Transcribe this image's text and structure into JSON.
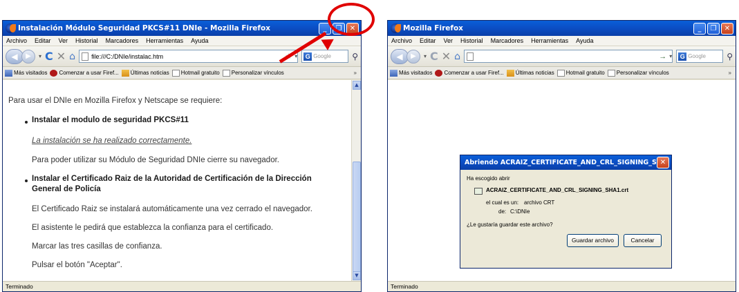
{
  "window1": {
    "title": "Instalación Módulo Seguridad PKCS#11 DNIe - Mozilla Firefox",
    "menu": [
      "Archivo",
      "Editar",
      "Ver",
      "Historial",
      "Marcadores",
      "Herramientas",
      "Ayuda"
    ],
    "url": "file:///C:/DNIe/instalac.htm",
    "search_placeholder": "Google",
    "bookmarks": [
      "Más visitados",
      "Comenzar a usar Firef...",
      "Últimas noticias",
      "Hotmail gratuito",
      "Personalizar vínculos"
    ],
    "status": "Terminado",
    "content": {
      "intro": "Para usar el DNIe en Mozilla Firefox y Netscape se requiere:",
      "bullet1": "Instalar el modulo de seguridad PKCS#11",
      "success_link": "La instalación se ha realizado correctamente.",
      "close_note": "Para poder utilizar su Módulo de Seguridad DNIe cierre su navegador.",
      "bullet2_line1": "Instalar el Certificado Raiz de la Autoridad de Certificación de la Dirección",
      "bullet2_line2": "General de Policía",
      "step1": "El Certificado Raiz se instalará automáticamente una vez cerrado el navegador.",
      "step2": "El asistente le pedirá que establezca la confianza para el certificado.",
      "step3": "Marcar las tres casillas de confianza.",
      "step4": "Pulsar el botón \"Aceptar\"."
    }
  },
  "window2": {
    "title": "Mozilla Firefox",
    "menu": [
      "Archivo",
      "Editar",
      "Ver",
      "Historial",
      "Marcadores",
      "Herramientas",
      "Ayuda"
    ],
    "url": "",
    "search_placeholder": "Google",
    "bookmarks": [
      "Más visitados",
      "Comenzar a usar Firef...",
      "Últimas noticias",
      "Hotmail gratuito",
      "Personalizar vínculos"
    ],
    "status": "Terminado",
    "dialog": {
      "title": "Abriendo ACRAIZ_CERTIFICATE_AND_CRL_SIGNING_S...",
      "chosen_label": "Ha escogido abrir",
      "filename": "ACRAIZ_CERTIFICATE_AND_CRL_SIGNING_SHA1.crt",
      "type_label": "el cual es un:",
      "type_value": "archivo CRT",
      "from_label": "de:",
      "from_value": "C:\\DNIe",
      "question": "¿Le gustaría guardar este archivo?",
      "save_button": "Guardar archivo",
      "cancel_button": "Cancelar"
    }
  },
  "annotation_color": "#e00000"
}
